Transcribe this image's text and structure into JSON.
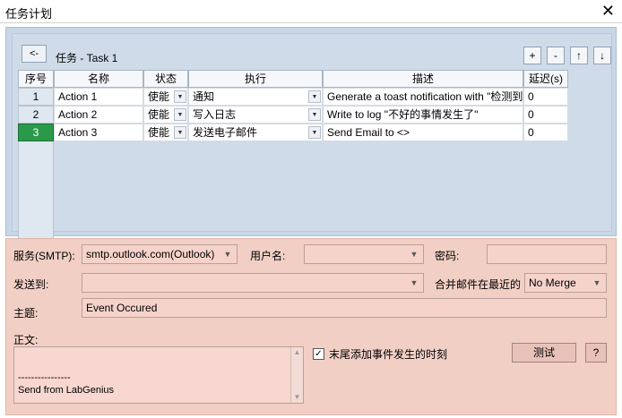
{
  "window": {
    "title": "任务计划",
    "close_icon": "✕"
  },
  "task": {
    "back_label": "<-",
    "title": "任务 - Task 1",
    "tools": [
      "+",
      "-",
      "↑",
      "↓"
    ]
  },
  "grid": {
    "headers": [
      "序号",
      "名称",
      "状态",
      "执行",
      "描述",
      "延迟(s)"
    ],
    "rows": [
      {
        "idx": "1",
        "name": "Action 1",
        "status": "使能",
        "action": "通知",
        "desc": "Generate a toast notification with \"检测到电",
        "delay": "0"
      },
      {
        "idx": "2",
        "name": "Action 2",
        "status": "使能",
        "action": "写入日志",
        "desc": "Write to log \"不好的事情发生了\"",
        "delay": "0"
      },
      {
        "idx": "3",
        "name": "Action 3",
        "status": "使能",
        "action": "发送电子邮件",
        "desc": "Send Email to <>",
        "delay": "0"
      }
    ]
  },
  "email": {
    "service_label": "服务(SMTP):",
    "service_value": "smtp.outlook.com(Outlook)",
    "username_label": "用户名:",
    "username_value": "",
    "password_label": "密码:",
    "password_value": "",
    "sendto_label": "发送到:",
    "sendto_value": "",
    "merge_label": "合并邮件在最近的",
    "merge_value": "No Merge",
    "subject_label": "主题:",
    "subject_value": "Event Occured",
    "body_label": "正文:",
    "body_lines": [
      "----------------",
      "Send from LabGenius"
    ],
    "append_time_label": "末尾添加事件发生的时刻",
    "append_time_checked": "✓",
    "test_button": "测试",
    "help_button": "?"
  }
}
